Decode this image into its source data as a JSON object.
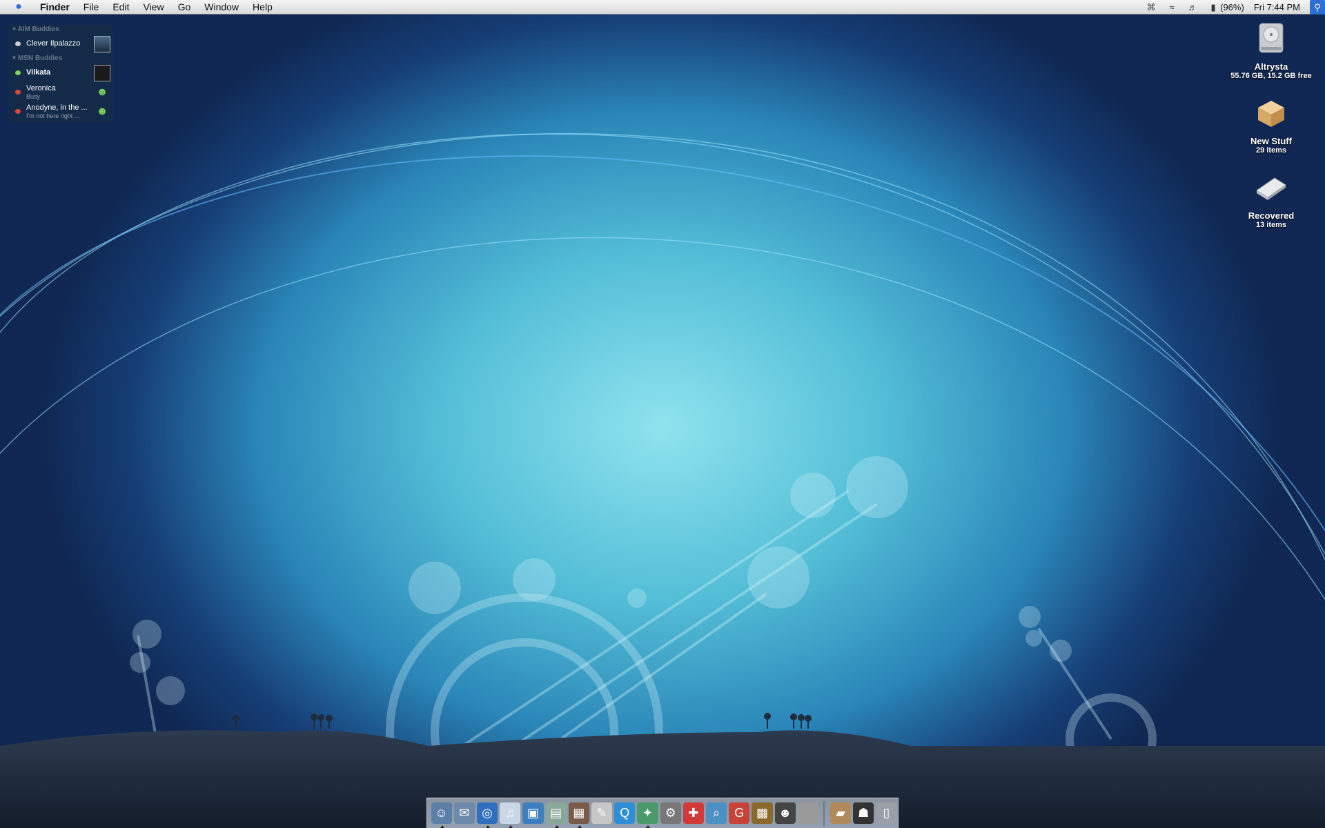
{
  "menubar": {
    "app_name": "Finder",
    "menus": [
      "File",
      "Edit",
      "View",
      "Go",
      "Window",
      "Help"
    ],
    "battery": "(96%)",
    "clock": "Fri 7:44 PM",
    "status_icons": [
      "bluetooth-icon",
      "wifi-icon",
      "volume-icon",
      "battery-icon",
      "spotlight-icon"
    ]
  },
  "buddy_list": {
    "groups": [
      {
        "title": "AIM Buddies",
        "buddies": [
          {
            "name": "Clever Ilpalazzo",
            "message": "",
            "status": "away",
            "status_color": "#cccccc"
          }
        ]
      },
      {
        "title": "MSN Buddies",
        "buddies": [
          {
            "name": "Vilkata",
            "message": "",
            "status": "available",
            "status_color": "#7ed35d"
          },
          {
            "name": "Veronica",
            "message": "Busy",
            "status": "busy",
            "status_color": "#e0463c"
          },
          {
            "name": "Anodyne, in the ...",
            "message": "I'm not here right ...",
            "status": "busy",
            "status_color": "#e0463c"
          }
        ]
      }
    ]
  },
  "desktop_icons": [
    {
      "label": "Altrysta",
      "sub": "55.76 GB, 15.2 GB free",
      "icon": "hard-drive-icon"
    },
    {
      "label": "New Stuff",
      "sub": "29 items",
      "icon": "box-folder-icon"
    },
    {
      "label": "Recovered",
      "sub": "13 items",
      "icon": "folder-icon"
    }
  ],
  "dock": {
    "apps": [
      {
        "icon": "finder-icon",
        "color": "#5c7fa8",
        "glyph": "☺",
        "running": true
      },
      {
        "icon": "mail-icon",
        "color": "#6f8aa8",
        "glyph": "✉",
        "running": false
      },
      {
        "icon": "safari-icon",
        "color": "#2f6fbf",
        "glyph": "◎",
        "running": true
      },
      {
        "icon": "itunes-icon",
        "color": "#c9d7e6",
        "glyph": "♫",
        "running": true
      },
      {
        "icon": "iphoto-icon",
        "color": "#3f7fbf",
        "glyph": "▣",
        "running": false
      },
      {
        "icon": "trashcan-app-icon",
        "color": "#8aa89a",
        "glyph": "▤",
        "running": true
      },
      {
        "icon": "photo-booth-icon",
        "color": "#7a5a4a",
        "glyph": "▦",
        "running": true
      },
      {
        "icon": "textedit-icon",
        "color": "#c7c7c7",
        "glyph": "✎",
        "running": false
      },
      {
        "icon": "quicktime-icon",
        "color": "#2f8fd6",
        "glyph": "Q",
        "running": false
      },
      {
        "icon": "adium-icon",
        "color": "#4a9a6a",
        "glyph": "✦",
        "running": true
      },
      {
        "icon": "utility-icon",
        "color": "#777777",
        "glyph": "⚙",
        "running": false
      },
      {
        "icon": "cross-icon",
        "color": "#d23a3a",
        "glyph": "✚",
        "running": false
      },
      {
        "icon": "preview-icon",
        "color": "#4a90c2",
        "glyph": "⌕",
        "running": false
      },
      {
        "icon": "red-app-icon",
        "color": "#c8423a",
        "glyph": "G",
        "running": false
      },
      {
        "icon": "dosbox-icon",
        "color": "#8a6a2a",
        "glyph": "▩",
        "running": false
      },
      {
        "icon": "spy-icon",
        "color": "#444444",
        "glyph": "☻",
        "running": false
      },
      {
        "icon": "system-icon",
        "color": "#9a9a9a",
        "glyph": "",
        "running": false
      }
    ],
    "docs": [
      {
        "icon": "box-stack-icon",
        "color": "#b08a5a",
        "glyph": "▰"
      },
      {
        "icon": "avatar-icon",
        "color": "#333333",
        "glyph": "☗"
      },
      {
        "icon": "trash-icon",
        "color": "#9aa0a6",
        "glyph": "▯"
      }
    ]
  }
}
